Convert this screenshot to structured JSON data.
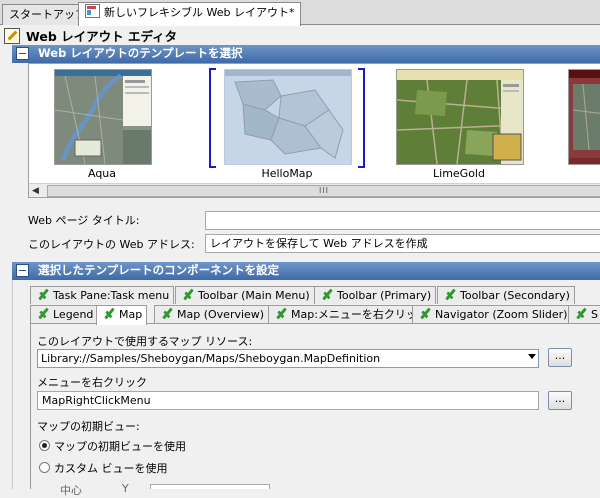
{
  "doc_tabs": [
    {
      "label": "スタートアップ",
      "active": false
    },
    {
      "label": "新しいフレキシブル Web レイアウト*",
      "active": true
    }
  ],
  "editor": {
    "title": "Web レイアウト エディタ"
  },
  "template_section": {
    "title": "Web レイアウトのテンプレートを選択",
    "templates": [
      {
        "name": "Aqua",
        "selected": false
      },
      {
        "name": "HelloMap",
        "selected": true
      },
      {
        "name": "LimeGold",
        "selected": false
      },
      {
        "name": "",
        "selected": false
      }
    ],
    "scroll_grip": "III"
  },
  "web_page": {
    "title_label": "Web ページ タイトル:",
    "title_value": "",
    "address_label": "このレイアウトの Web アドレス:",
    "address_value": "レイアウトを保存して Web アドレスを作成"
  },
  "components_section": {
    "title": "選択したテンプレートのコンポーネントを設定",
    "tabs_row1": [
      "Task Pane:Task menu",
      "Toolbar (Main Menu)",
      "Toolbar (Primary)",
      "Toolbar (Secondary)"
    ],
    "tabs_row2": [
      "Legend",
      "Map",
      "Map (Overview)",
      "Map:メニューを右クリック",
      "Navigator (Zoom Slider)",
      "S"
    ],
    "active_tab": "Map"
  },
  "map_panel": {
    "resource_label": "このレイアウトで使用するマップ リソース:",
    "resource_value": "Library://Samples/Sheboygan/Maps/Sheboygan.MapDefinition",
    "browse_label": "...",
    "context_label": "メニューを右クリック",
    "context_value": "MapRightClickMenu",
    "context_browse_label": "...",
    "initial_view_label": "マップの初期ビュー:",
    "radio_use_initial": "マップの初期ビューを使用",
    "radio_custom": "カスタム ビューを使用",
    "selected_view": "use_initial",
    "center_label": "中心",
    "y_label": "Y"
  },
  "colors": {
    "section_header": "#4a74b0",
    "selection_bracket": "#1a1acc",
    "check_green": "#2f9a2f"
  }
}
